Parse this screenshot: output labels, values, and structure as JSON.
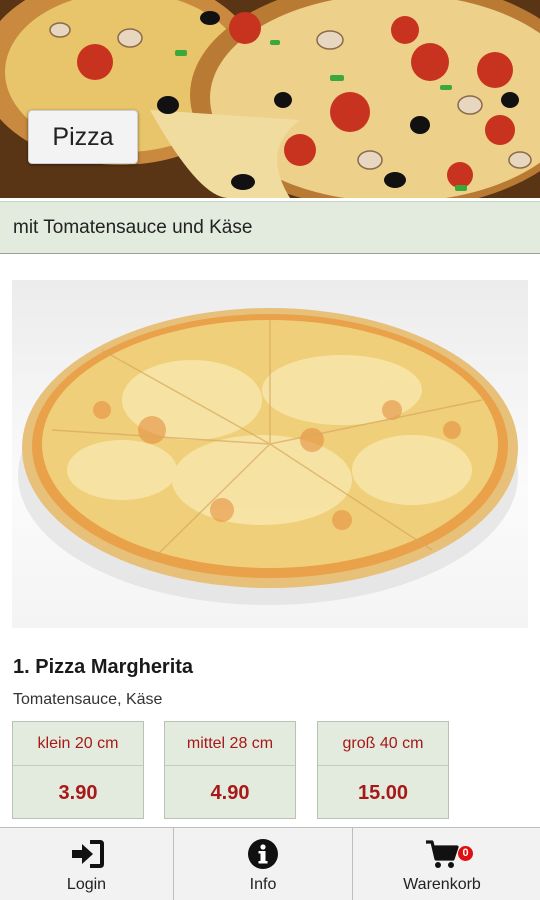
{
  "header": {
    "category_button": "Pizza"
  },
  "subtitle": "mit Tomatensauce und Käse",
  "product": {
    "title": "1. Pizza Margherita",
    "description": "Tomatensauce, Käse",
    "sizes": [
      {
        "label": "klein 20 cm",
        "price": "3.90"
      },
      {
        "label": "mittel 28 cm",
        "price": "4.90"
      },
      {
        "label": "groß 40 cm",
        "price": "15.00"
      }
    ]
  },
  "nav": {
    "items": [
      {
        "label": "Login",
        "icon": "login-icon"
      },
      {
        "label": "Info",
        "icon": "info-icon"
      },
      {
        "label": "Warenkorb",
        "icon": "cart-icon"
      }
    ],
    "cart_badge": "0"
  },
  "colors": {
    "accent_bar": "#e2ebde",
    "price_red": "#a81818",
    "badge_red": "#e01010"
  }
}
